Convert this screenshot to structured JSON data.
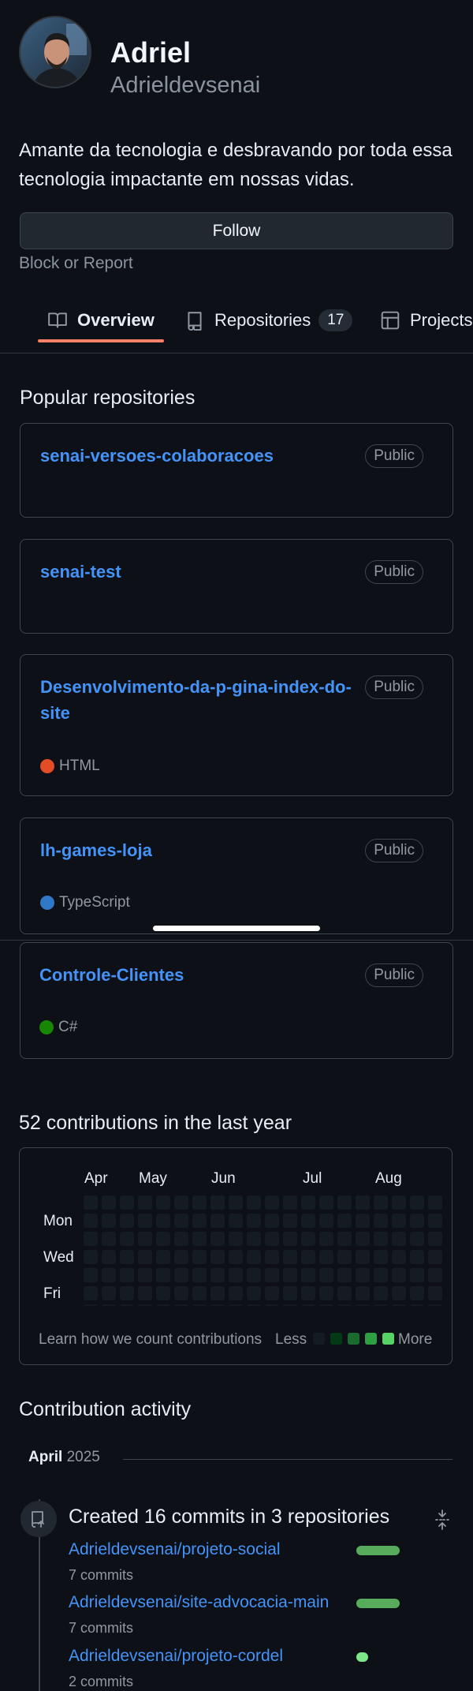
{
  "profile": {
    "name": "Adriel",
    "login": "Adrieldevsenai",
    "bio": "Amante da tecnologia e desbravando por toda essa tecnologia impactante em nossas vidas.",
    "follow_label": "Follow",
    "block_label": "Block or Report"
  },
  "tabs": [
    {
      "label": "Overview",
      "icon": "book-icon",
      "active": true
    },
    {
      "label": "Repositories",
      "icon": "repo-icon",
      "count": "17"
    },
    {
      "label": "Projects",
      "icon": "table-icon"
    }
  ],
  "popular": {
    "title": "Popular repositories",
    "repos": [
      {
        "name": "senai-versoes-colaboracoes",
        "visibility": "Public"
      },
      {
        "name": "senai-test",
        "visibility": "Public"
      },
      {
        "name": "Desenvolvimento-da-p-gina-index-do-site",
        "visibility": "Public",
        "language": "HTML",
        "language_color": "#e34c26"
      },
      {
        "name": "lh-games-loja",
        "visibility": "Public",
        "language": "TypeScript",
        "language_color": "#3178c6"
      },
      {
        "name": "Controle-Clientes",
        "visibility": "Public",
        "language": "C#",
        "language_color": "#178600"
      }
    ]
  },
  "contributions": {
    "title": "52 contributions in the last year",
    "months": [
      "Apr",
      "May",
      "Jun",
      "Jul",
      "Aug"
    ],
    "days": [
      "Mon",
      "Wed",
      "Fri"
    ],
    "learn_label": "Learn how we count contributions",
    "less_label": "Less",
    "more_label": "More",
    "legend_colors": [
      "#151b23",
      "#033a16",
      "#196c2e",
      "#2ea043",
      "#56d364"
    ]
  },
  "activity": {
    "title": "Contribution activity",
    "month": "April",
    "year": "2025",
    "summary": "Created 16 commits in 3 repositories",
    "repos": [
      {
        "name": "Adrieldevsenai/projeto-social",
        "commits": "7 commits",
        "share": 0.44
      },
      {
        "name": "Adrieldevsenai/site-advocacia-main",
        "commits": "7 commits",
        "share": 0.44
      },
      {
        "name": "Adrieldevsenai/projeto-cordel",
        "commits": "2 commits",
        "share": 0.12
      }
    ],
    "bar_color": "#57ab5a"
  },
  "colors": {
    "background": "#0d1117",
    "link": "#4493f8",
    "tab_accent": "#f78166"
  }
}
